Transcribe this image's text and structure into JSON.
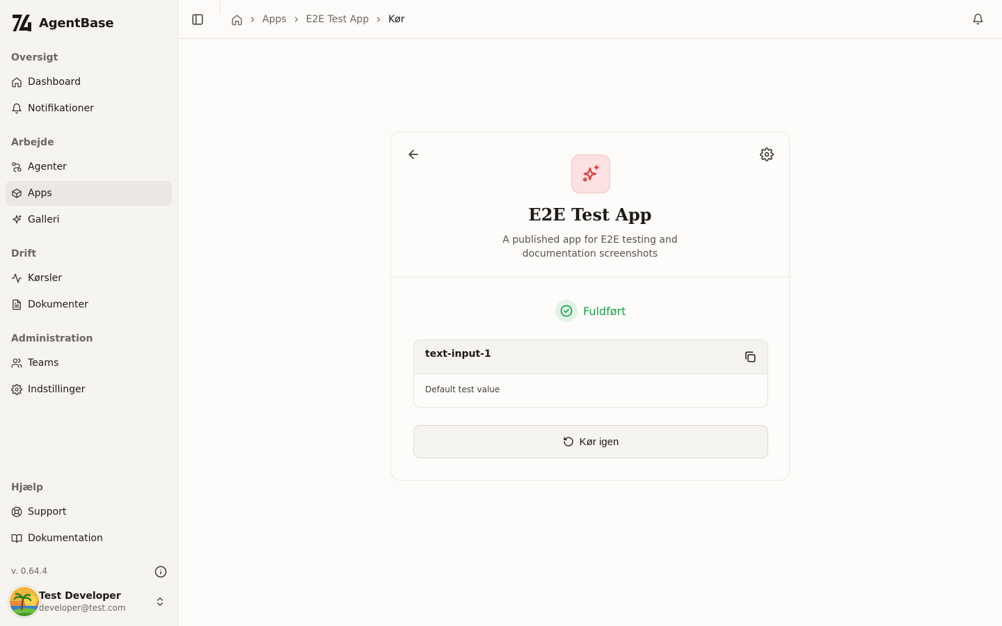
{
  "brand": {
    "name": "AgentBase"
  },
  "sidebar": {
    "sections": {
      "overview": "Oversigt",
      "work": "Arbejde",
      "operations": "Drift",
      "administration": "Administration",
      "help": "Hjælp"
    },
    "items": {
      "dashboard": "Dashboard",
      "notifications": "Notifikationer",
      "agents": "Agenter",
      "apps": "Apps",
      "gallery": "Galleri",
      "runs": "Kørsler",
      "documents": "Dokumenter",
      "teams": "Teams",
      "settings": "Indstillinger",
      "support": "Support",
      "documentation": "Dokumentation"
    },
    "active_item": "apps",
    "version": "v. 0.64.4",
    "user": {
      "name": "Test Developer",
      "email": "developer@test.com"
    }
  },
  "topbar": {
    "breadcrumb": [
      "Apps",
      "E2E Test App",
      "Kør"
    ]
  },
  "app": {
    "title": "E2E Test App",
    "description": "A published app for E2E testing and documentation screenshots",
    "status": "Fuldført",
    "output": {
      "key": "text-input-1",
      "value": "Default test value"
    },
    "rerun_label": "Kør igen"
  },
  "colors": {
    "accent": "#d93b3b",
    "success": "#16a34a",
    "sidebar_bg": "#f6f4f0",
    "page_bg": "#fcfbf9"
  },
  "icons": [
    "agentbase-logo",
    "home-icon",
    "bell-icon",
    "route-icon",
    "box-icon",
    "sparkles-icon",
    "activity-icon",
    "file-text-icon",
    "users-icon",
    "gear-icon",
    "life-buoy-icon",
    "book-icon",
    "info-icon",
    "chevrons-up-down-icon",
    "sidebar-toggle-icon",
    "arrow-left-icon",
    "check-circle-icon",
    "copy-icon",
    "rotate-ccw-icon"
  ]
}
